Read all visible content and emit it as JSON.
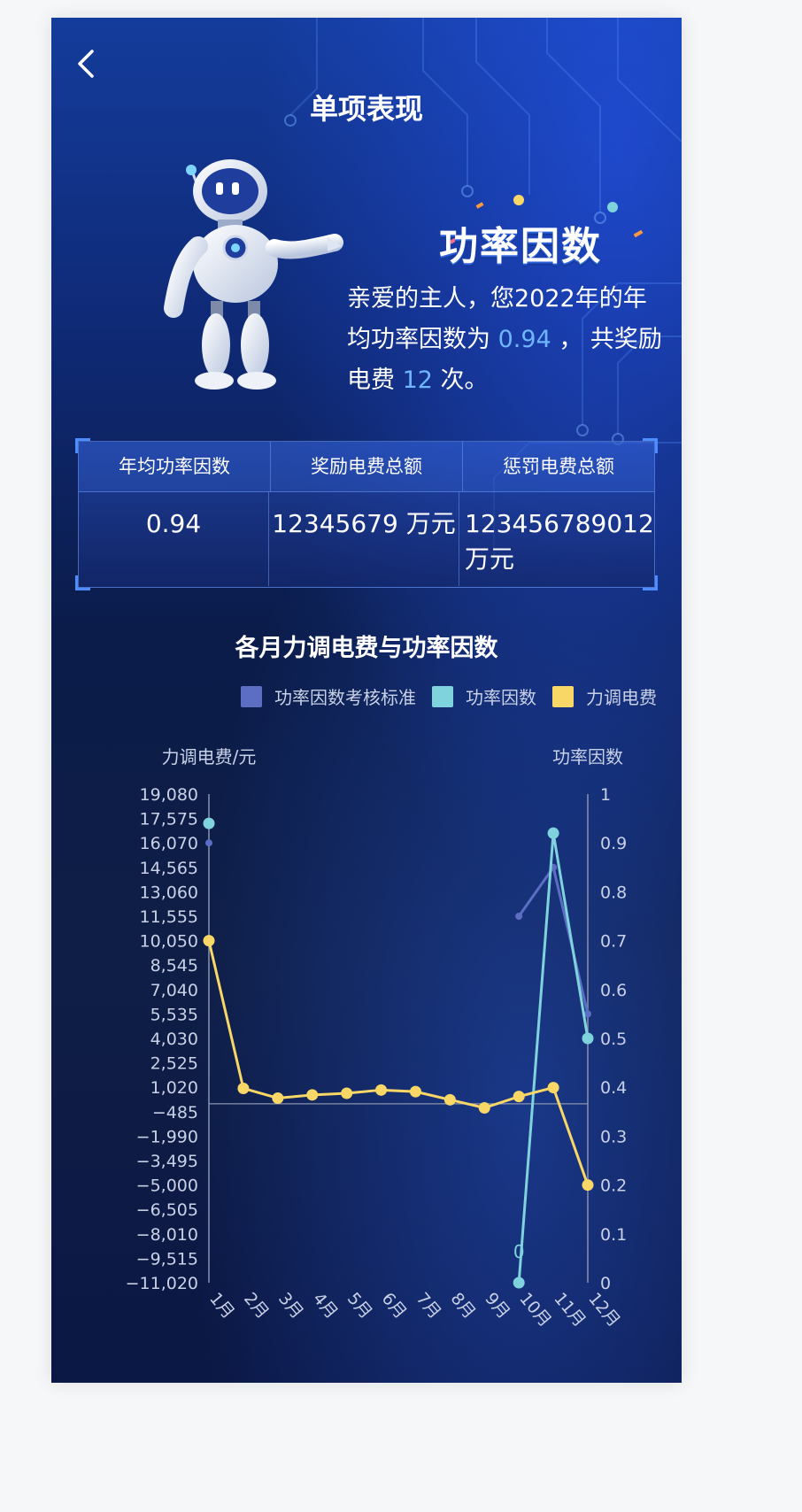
{
  "header": {
    "title": "单项表现"
  },
  "hero": {
    "badge": "功率因数",
    "intro_prefix": "亲爱的主人，您2022年的年均功率因数为",
    "avg_value": "0.94",
    "intro_middle": "， 共奖励电费",
    "reward_times": "12",
    "intro_suffix": "次。"
  },
  "stats": {
    "headers": [
      "年均功率因数",
      "奖励电费总额",
      "惩罚电费总额"
    ],
    "values": [
      "0.94",
      "12345679 万元",
      "123456789012 万元"
    ]
  },
  "colors": {
    "standard": "#5b6ec4",
    "power_factor": "#7fd3dd",
    "fee": "#f8d766",
    "accent": "#6fb6ff"
  },
  "icons": {
    "back": "chevron-left-icon",
    "robot": "robot-illustration"
  },
  "chart_data": {
    "type": "line",
    "title": "各月力调电费与功率因数",
    "categories": [
      "1月",
      "2月",
      "3月",
      "4月",
      "5月",
      "6月",
      "7月",
      "8月",
      "9月",
      "10月",
      "11月",
      "12月"
    ],
    "y_left": {
      "label": "力调电费/元",
      "ticks": [
        "19,080",
        "17,575",
        "16,070",
        "14,565",
        "13,060",
        "11,555",
        "10,050",
        "8,545",
        "7,040",
        "5,535",
        "4,030",
        "2,525",
        "1,020",
        "−485",
        "−1,990",
        "−3,495",
        "−5,000",
        "−6,505",
        "−8,010",
        "−9,515",
        "−11,020"
      ],
      "min": -11020,
      "max": 19080
    },
    "y_right": {
      "label": "功率因数",
      "ticks": [
        "1",
        "0.9",
        "0.8",
        "0.7",
        "0.6",
        "0.5",
        "0.4",
        "0.3",
        "0.2",
        "0.1",
        "0"
      ],
      "min": 0,
      "max": 1
    },
    "series": [
      {
        "name": "功率因数考核标准",
        "axis": "right",
        "color": "#5b6ec4",
        "values": [
          0.9,
          null,
          null,
          null,
          null,
          null,
          null,
          null,
          null,
          0.75,
          0.85,
          0.55
        ]
      },
      {
        "name": "功率因数",
        "axis": "right",
        "color": "#7fd3dd",
        "values": [
          0.94,
          null,
          null,
          null,
          null,
          null,
          null,
          null,
          null,
          0,
          0.92,
          0.5
        ]
      },
      {
        "name": "力调电费",
        "axis": "left",
        "color": "#f8d766",
        "values": [
          10050,
          950,
          350,
          550,
          650,
          850,
          750,
          250,
          -250,
          450,
          1000,
          -5000
        ]
      }
    ],
    "annotations": [
      {
        "text": "0",
        "category": "10月",
        "value": 0.04,
        "axis": "right"
      }
    ]
  }
}
